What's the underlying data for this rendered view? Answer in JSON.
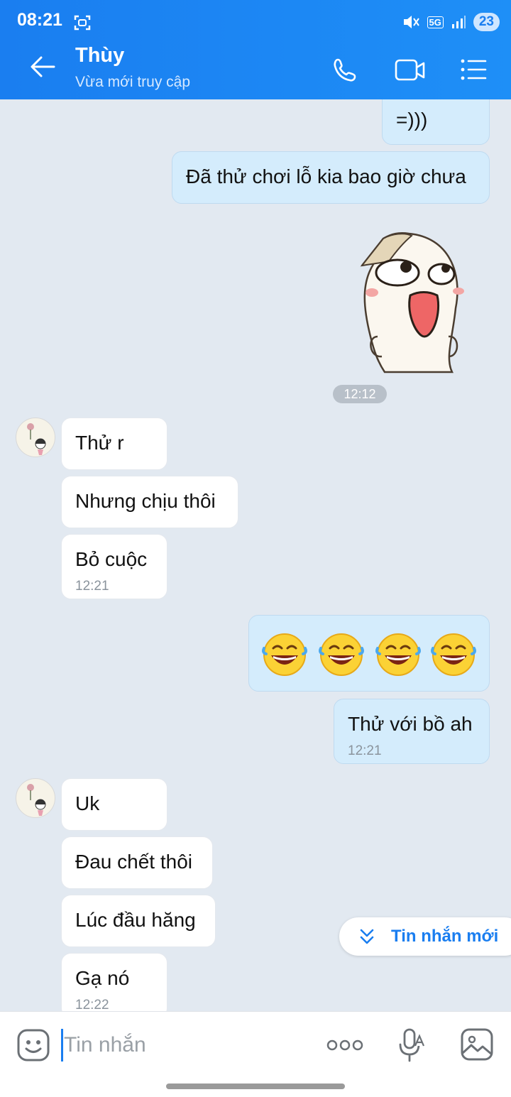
{
  "status_bar": {
    "time": "08:21",
    "network": "5G",
    "battery": "23"
  },
  "header": {
    "title": "Thùy",
    "subtitle": "Vừa mới truy cập"
  },
  "messages": {
    "m1": {
      "text": "=)))"
    },
    "m2": {
      "text": "Đã thử chơi lỗ kia bao giờ chưa"
    },
    "time_divider": "12:12",
    "m3": {
      "text": "Thử r"
    },
    "m4": {
      "text": "Nhưng chịu thôi"
    },
    "m5": {
      "text": "Bỏ cuộc",
      "time": "12:21"
    },
    "m6": {
      "emoji": [
        "😂",
        "😂",
        "😂",
        "😂"
      ]
    },
    "m7": {
      "text": "Thử với bồ ah",
      "time": "12:21"
    },
    "m8": {
      "text": "Uk"
    },
    "m9": {
      "text": "Đau chết thôi"
    },
    "m10": {
      "text": "Lúc đầu hăng"
    },
    "m11": {
      "text": "Gạ nó",
      "time": "12:22"
    }
  },
  "new_messages_button": {
    "label": "Tin nhắn mới"
  },
  "composer": {
    "placeholder": "Tin nhắn"
  },
  "colors": {
    "accent": "#1a7ef0",
    "outgoing_bubble": "#d4ecfc",
    "incoming_bubble": "#ffffff",
    "chat_bg": "#e2e9f1"
  },
  "icons": [
    "back-arrow-icon",
    "phone-icon",
    "video-call-icon",
    "menu-list-icon",
    "sticker-icon",
    "more-icon",
    "voice-icon",
    "image-icon",
    "chevron-down-icon"
  ]
}
